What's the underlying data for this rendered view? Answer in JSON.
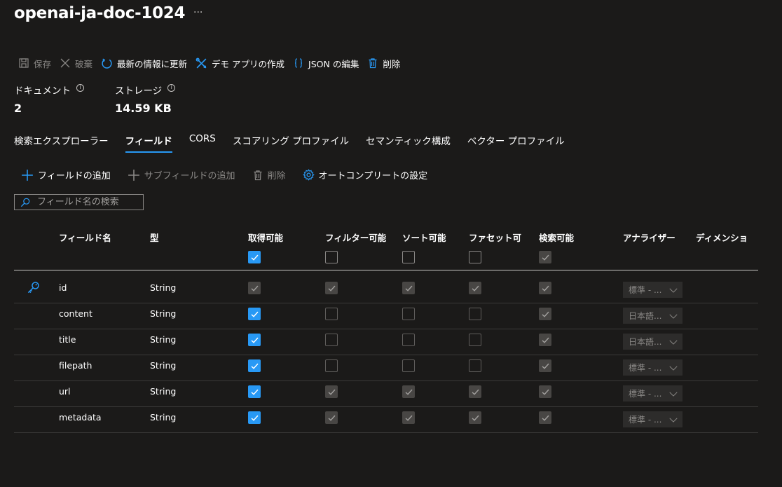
{
  "page": {
    "title": "openai-ja-doc-1024",
    "more": "···"
  },
  "commands": [
    {
      "label": "保存",
      "icon": "save-icon",
      "enabled": false
    },
    {
      "label": "破棄",
      "icon": "close-icon",
      "enabled": false
    },
    {
      "label": "最新の情報に更新",
      "icon": "refresh-icon",
      "enabled": true
    },
    {
      "label": "デモ アプリの作成",
      "icon": "tools-icon",
      "enabled": true
    },
    {
      "label": "JSON の編集",
      "icon": "braces-icon",
      "enabled": true
    },
    {
      "label": "削除",
      "icon": "trash-icon",
      "enabled": true
    }
  ],
  "stats": [
    {
      "label": "ドキュメント",
      "value": "2"
    },
    {
      "label": "ストレージ",
      "value": "14.59 KB"
    }
  ],
  "info_glyph": "i",
  "tabs": [
    {
      "label": "検索エクスプローラー",
      "active": false
    },
    {
      "label": "フィールド",
      "active": true
    },
    {
      "label": "CORS",
      "active": false
    },
    {
      "label": "スコアリング プロファイル",
      "active": false
    },
    {
      "label": "セマンティック構成",
      "active": false
    },
    {
      "label": "ベクター プロファイル",
      "active": false
    }
  ],
  "field_toolbar": {
    "add_field": "フィールドの追加",
    "add_subfield": "サブフィールドの追加",
    "delete": "削除",
    "autocomplete": "オートコンプリートの設定"
  },
  "search": {
    "placeholder": "フィールド名の検索"
  },
  "table": {
    "columns": {
      "name": "フィールド名",
      "type": "型",
      "retrievable": "取得可能",
      "filterable": "フィルター可能",
      "sortable": "ソート可能",
      "facetable": "ファセット可",
      "searchable": "検索可能",
      "analyzer": "アナライザー",
      "dimensions": "ディメンショ"
    },
    "header_checks": {
      "retrievable": "on",
      "filterable": "off",
      "sortable": "off",
      "facetable": "off",
      "searchable": "dis-on"
    },
    "rows": [
      {
        "name": "id",
        "type": "String",
        "key": true,
        "retrievable": "dis-on",
        "filterable": "dis-on",
        "sortable": "dis-on",
        "facetable": "dis-on",
        "searchable": "dis-on",
        "analyzer": "標準 - ..."
      },
      {
        "name": "content",
        "type": "String",
        "key": false,
        "retrievable": "on",
        "filterable": "dis-off",
        "sortable": "dis-off",
        "facetable": "dis-off",
        "searchable": "dis-on",
        "analyzer": "日本語..."
      },
      {
        "name": "title",
        "type": "String",
        "key": false,
        "retrievable": "on",
        "filterable": "dis-off",
        "sortable": "dis-off",
        "facetable": "dis-off",
        "searchable": "dis-on",
        "analyzer": "日本語..."
      },
      {
        "name": "filepath",
        "type": "String",
        "key": false,
        "retrievable": "on",
        "filterable": "dis-off",
        "sortable": "dis-off",
        "facetable": "dis-off",
        "searchable": "dis-on",
        "analyzer": "標準 - ..."
      },
      {
        "name": "url",
        "type": "String",
        "key": false,
        "retrievable": "on",
        "filterable": "dis-on",
        "sortable": "dis-on",
        "facetable": "dis-on",
        "searchable": "dis-on",
        "analyzer": "標準 - ..."
      },
      {
        "name": "metadata",
        "type": "String",
        "key": false,
        "retrievable": "on",
        "filterable": "dis-on",
        "sortable": "dis-on",
        "facetable": "dis-on",
        "searchable": "dis-on",
        "analyzer": "標準 - ..."
      }
    ]
  },
  "colors": {
    "accent": "#2899f5",
    "background": "#1b1a19",
    "disabled_text": "#8a8886"
  }
}
